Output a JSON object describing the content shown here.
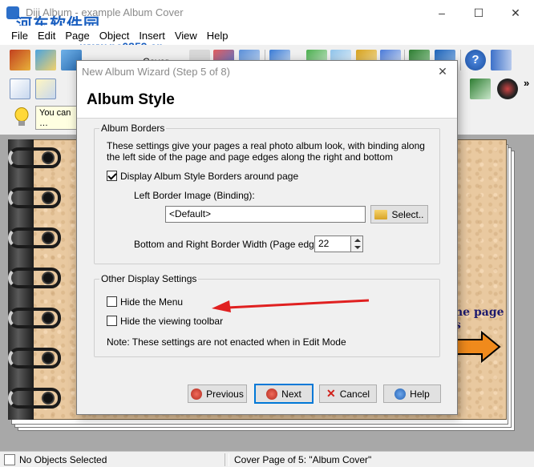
{
  "window": {
    "title": "Diji Album - example Album Cover",
    "minimize": "–",
    "maximize": "☐",
    "close": "✕"
  },
  "watermark": {
    "brand": "河东软件园",
    "url": "www.pc0359.cn"
  },
  "menu": [
    "File",
    "Edit",
    "Page",
    "Object",
    "Insert",
    "View",
    "Help"
  ],
  "toolbar": {
    "page_combo": "Cover"
  },
  "hint": {
    "text": "You can … Informatio…"
  },
  "canvas": {
    "page_text": "he page",
    "page_text2": "s"
  },
  "dialog": {
    "title": "New Album Wizard  (Step 5 of 8)",
    "close": "✕",
    "heading": "Album Style",
    "borders_group": {
      "legend": "Album Borders",
      "description": "These settings give your pages a real photo album look, with binding along the left side of the page and page edges along the right and bottom",
      "display_borders_label": "Display Album Style Borders around page",
      "display_borders_checked": true,
      "left_border_label": "Left Border Image (Binding):",
      "left_border_value": "<Default>",
      "select_button": "Select..",
      "width_label": "Bottom and Right Border Width (Page edges):",
      "width_value": "22"
    },
    "display_group": {
      "legend": "Other Display Settings",
      "hide_menu_label": "Hide the Menu",
      "hide_menu_checked": false,
      "hide_toolbar_label": "Hide the viewing toolbar",
      "hide_toolbar_checked": false,
      "note": "Note: These settings are not enacted when in Edit Mode"
    },
    "buttons": {
      "previous": "Previous",
      "next": "Next",
      "cancel": "Cancel",
      "help": "Help"
    }
  },
  "status": {
    "left": "No Objects Selected",
    "right": "Cover Page of 5: \"Album Cover\""
  },
  "colors": {
    "page_bg": "#e9c9a0",
    "binding": "#1b1b1b",
    "accent_blue": "#0078d7",
    "annotation_red": "#e02020",
    "arrow_orange": "#f08a1c"
  }
}
